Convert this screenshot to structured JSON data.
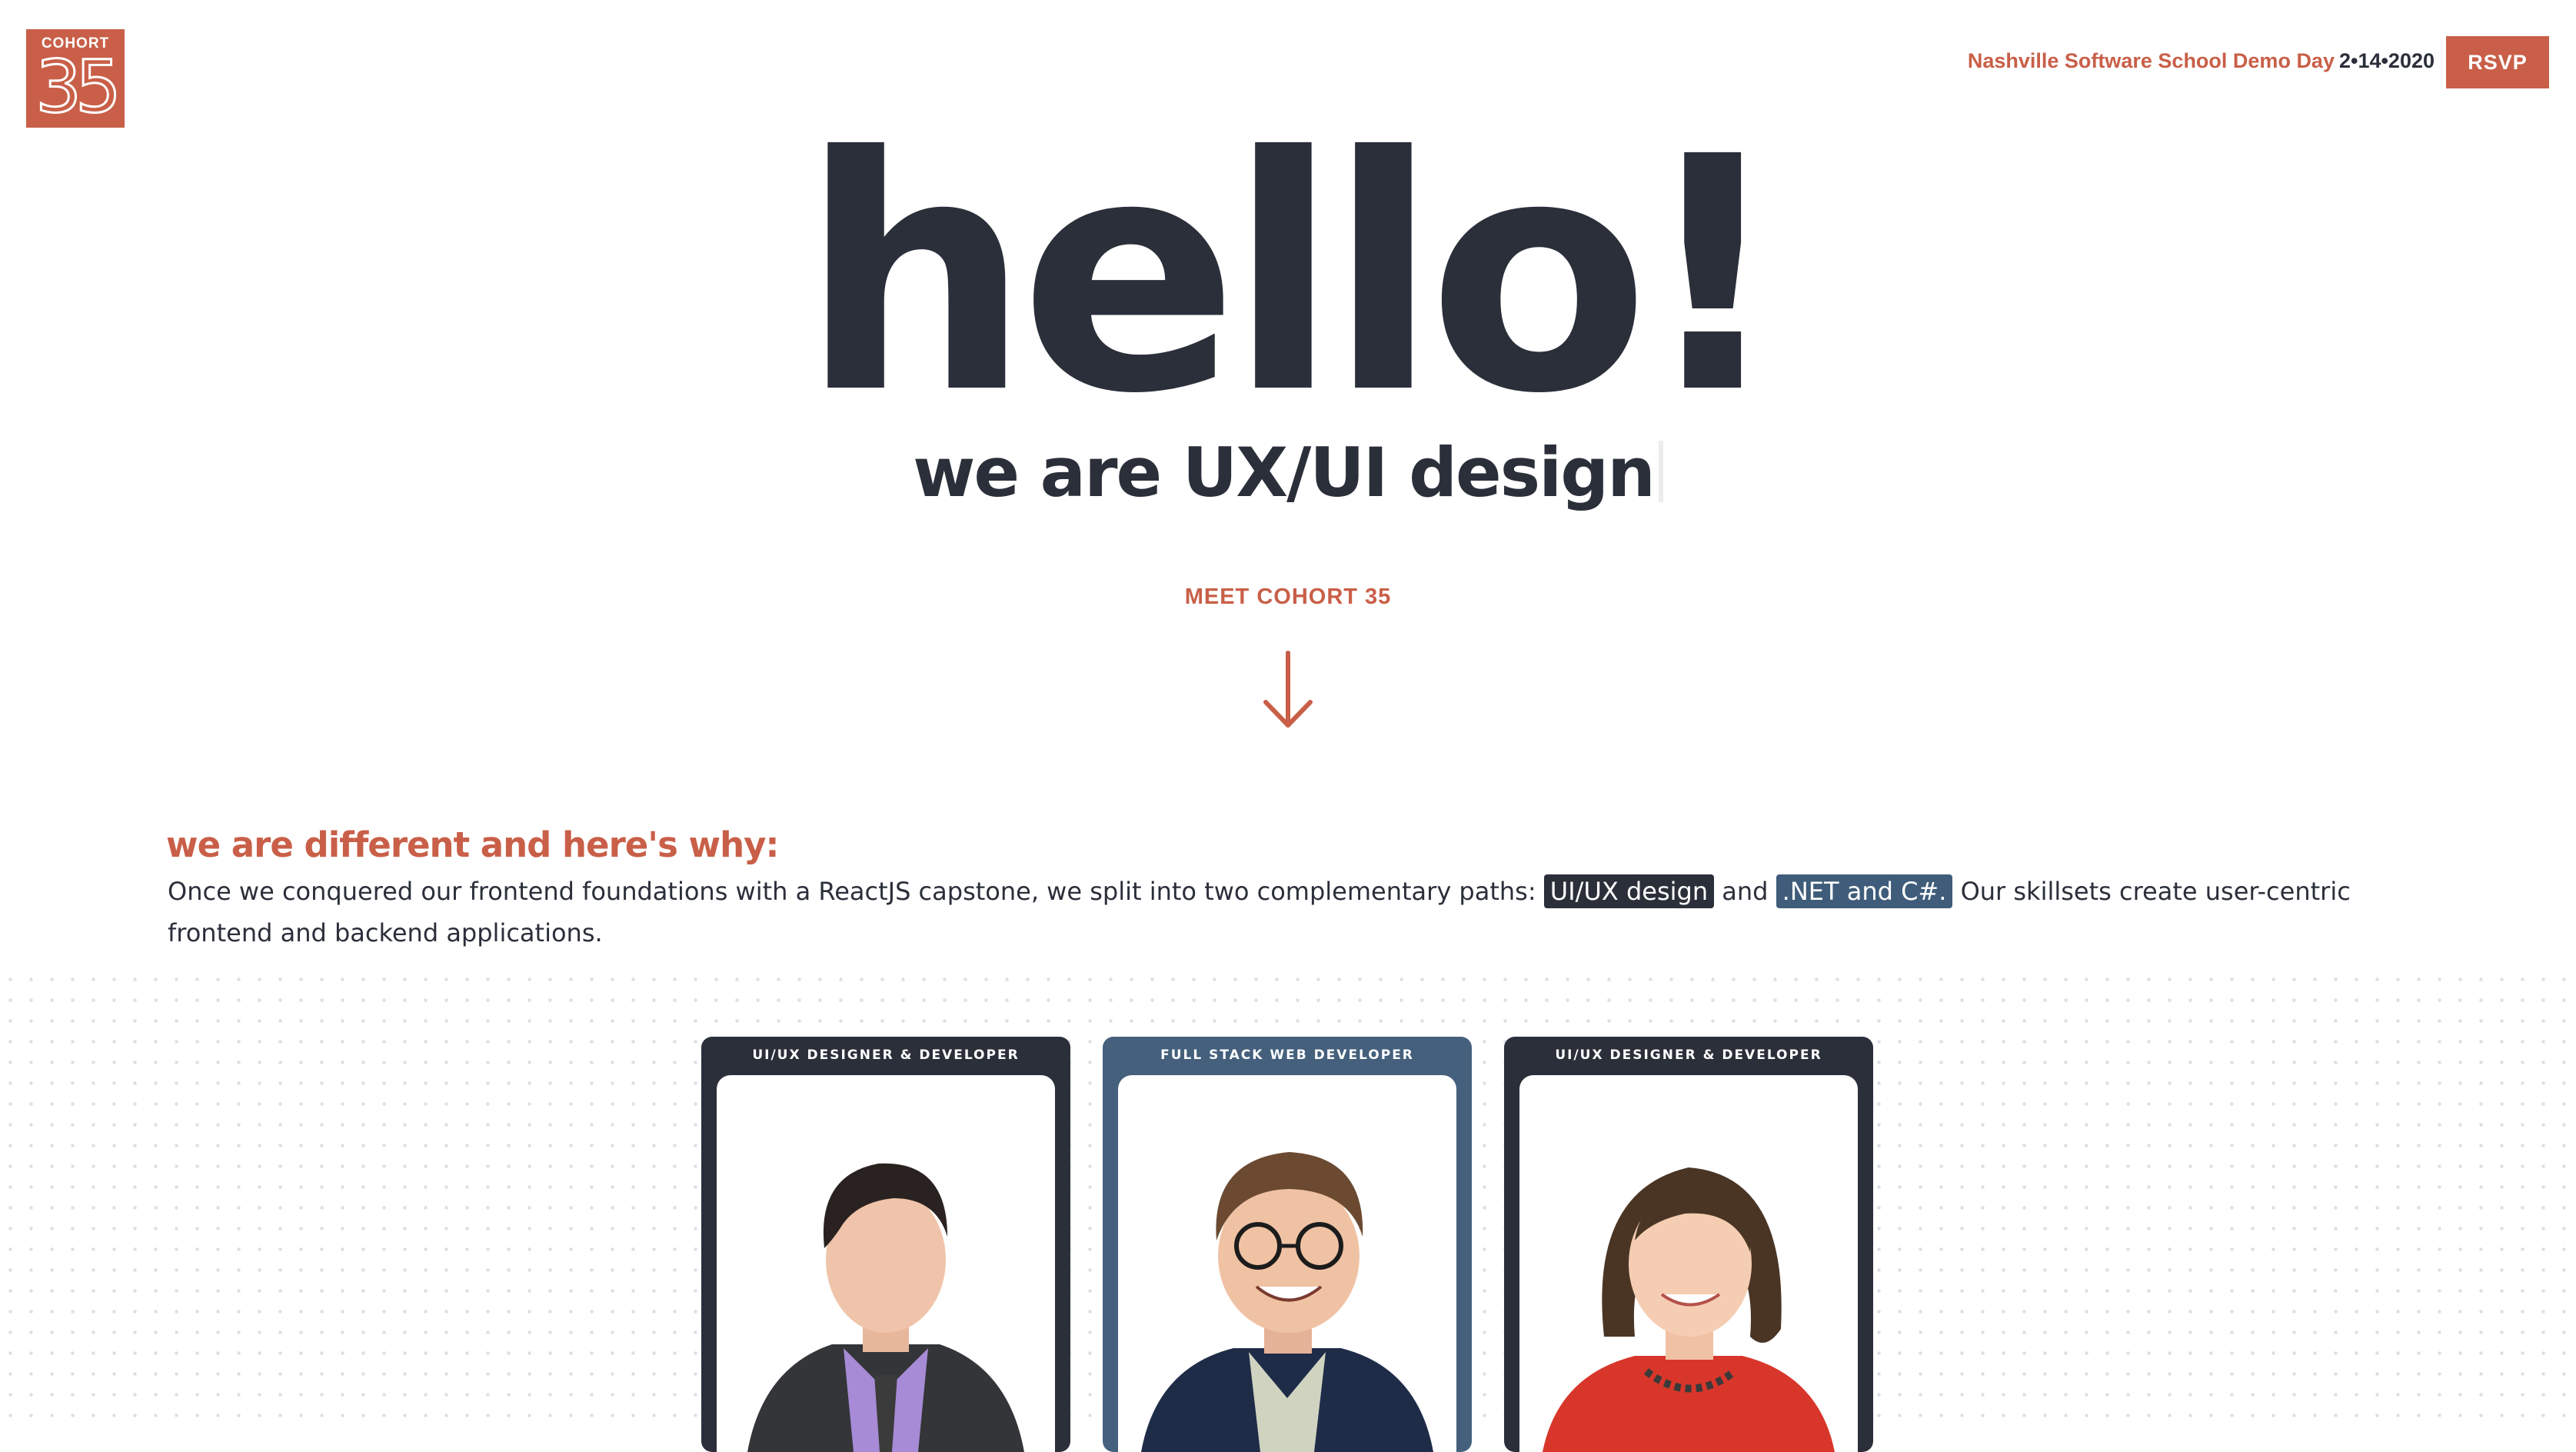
{
  "header": {
    "logo": {
      "word": "COHORT",
      "number": "35"
    },
    "event_name": "Nashville Software School Demo Day",
    "event_date": "2•14•2020",
    "rsvp_label": "RSVP"
  },
  "hero": {
    "title": "hello!",
    "subtitle": "we are UX/UI design",
    "meet_label": "MEET COHORT 35",
    "arrow_icon": "arrow-down-icon"
  },
  "intro": {
    "heading": "we are different and here's why:",
    "text_1": "Once we conquered our  frontend foundations  with a ReactJS capstone, we split into two complementary paths: ",
    "tag_1": "UI/UX design",
    "text_2": " and ",
    "tag_2": ".NET and C#.",
    "text_3": " Our skillsets create user-centric frontend and backend applications."
  },
  "cards": [
    {
      "role": "UI/UX DESIGNER & DEVELOPER",
      "style": "dark"
    },
    {
      "role": "FULL STACK WEB DEVELOPER",
      "style": "blue"
    },
    {
      "role": "UI/UX DESIGNER & DEVELOPER",
      "style": "dark"
    }
  ],
  "colors": {
    "accent": "#c95f48",
    "dark": "#2b2f3a",
    "blue": "#44607c",
    "tag_blue": "#3f5d7a"
  }
}
